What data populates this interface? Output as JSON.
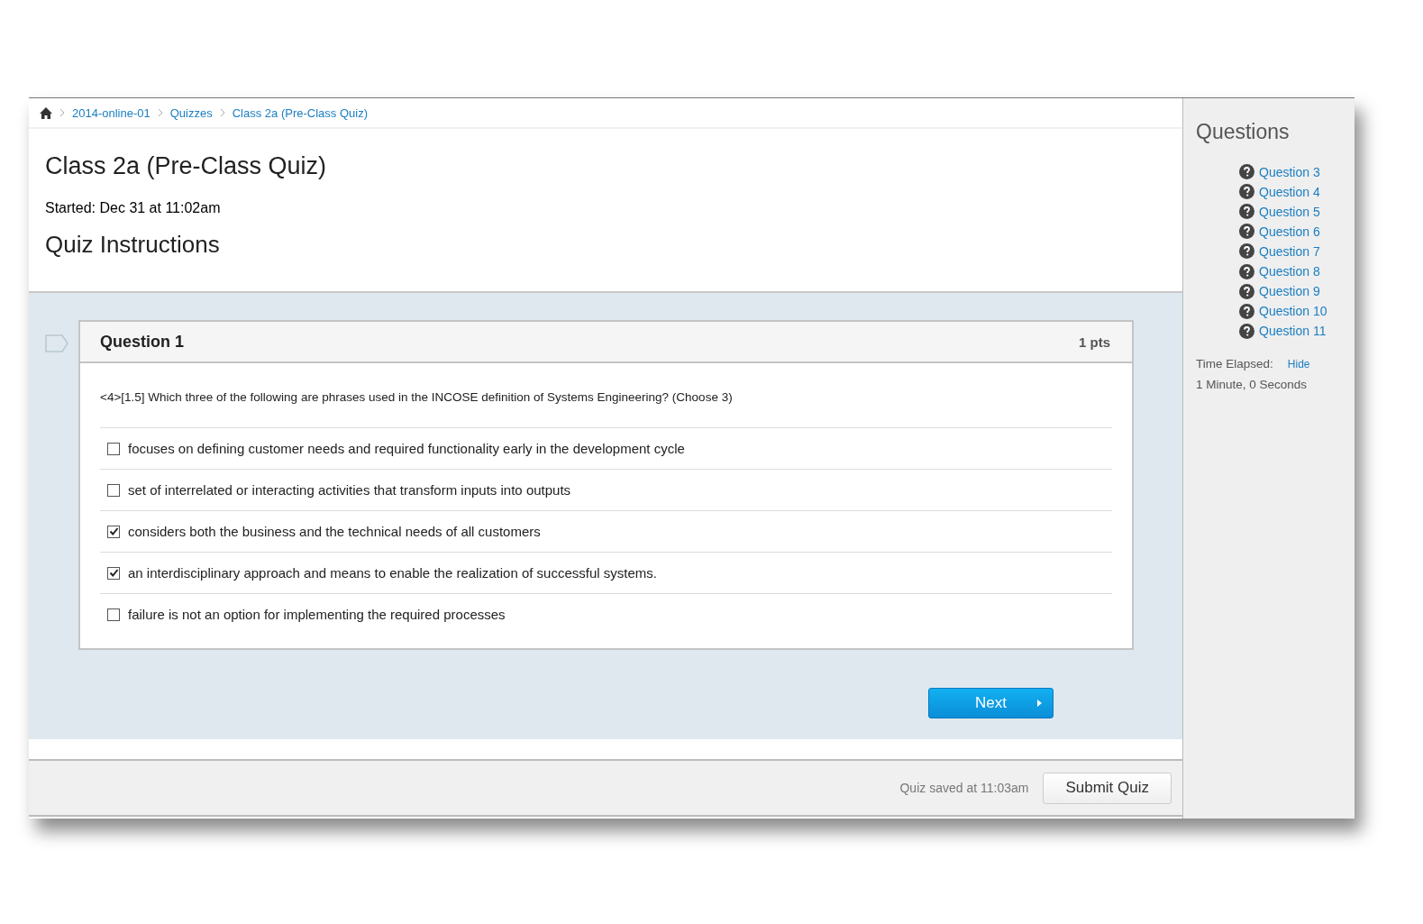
{
  "breadcrumb": [
    "2014-online-01",
    "Quizzes",
    "Class 2a (Pre-Class Quiz)"
  ],
  "title": "Class 2a (Pre-Class Quiz)",
  "started": "Started: Dec 31 at 11:02am",
  "instructions_heading": "Quiz Instructions",
  "question": {
    "title": "Question 1",
    "points": "1 pts",
    "text": "<4>[1.5] Which three of the following are phrases used in the INCOSE definition of Systems Engineering? (Choose 3)",
    "answers": [
      {
        "label": "focuses on defining customer needs and required functionality early in the development cycle",
        "checked": false
      },
      {
        "label": "set of interrelated or interacting activities that transform inputs into outputs",
        "checked": false
      },
      {
        "label": "considers both the business and the technical needs of all customers",
        "checked": true
      },
      {
        "label": "an interdisciplinary approach and means to enable the realization of successful systems.",
        "checked": true
      },
      {
        "label": "failure is not an option for implementing the required processes",
        "checked": false
      }
    ]
  },
  "next_button": "Next",
  "footer": {
    "saved": "Quiz saved at 11:03am",
    "submit": "Submit Quiz"
  },
  "sidebar": {
    "title": "Questions",
    "questions": [
      "Question 3",
      "Question 4",
      "Question 5",
      "Question 6",
      "Question 7",
      "Question 8",
      "Question 9",
      "Question 10",
      "Question 11"
    ],
    "time_label": "Time Elapsed:",
    "hide_link": "Hide",
    "time_value": "1 Minute, 0 Seconds"
  }
}
